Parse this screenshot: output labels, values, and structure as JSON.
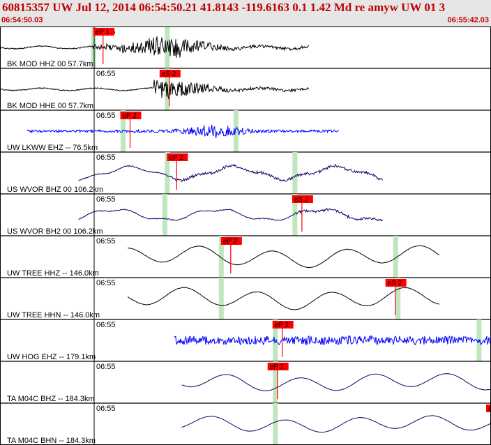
{
  "header": {
    "title": "60815357 UW Jul 12, 2014 06:54:50.21   41.8143 -119.6163  0.1 1.42 Md re amyw UW 01   3",
    "start_time": "06:54:50.03",
    "end_time": "06:55:42.03"
  },
  "colors": {
    "header_bg": "#e6e6e6",
    "header_text": "#c00000",
    "pick_red": "#ff0000",
    "window_green": "#bfe6bf",
    "trace_black": "#000000",
    "trace_blue": "#0000ff",
    "trace_navy": "#1a0066"
  },
  "tick_label": "06:55",
  "traces": [
    {
      "label": "BK MOD HHZ 00 57.7km",
      "color": "#000000",
      "type": "local",
      "start": 0.0,
      "end": 0.63,
      "onset": 0.19,
      "peak": 0.34,
      "amp": 0.78,
      "pick": {
        "label": "eP 1",
        "pos": 0.19
      },
      "window": 0.19,
      "arrival2": 0.34
    },
    {
      "label": "BK MOD HHE 00 57.7km",
      "color": "#000000",
      "type": "local",
      "start": 0.0,
      "end": 0.63,
      "onset": 0.31,
      "peak": 0.34,
      "amp": 0.72,
      "pick": {
        "label": "eS 2",
        "pos": 0.325
      },
      "window": 0.34,
      "arrival2": null
    },
    {
      "label": "UW LKWW EHZ -- 76.5km",
      "color": "#0000ff",
      "type": "noisy_event",
      "start": 0.055,
      "end": 0.69,
      "onset": 0.25,
      "peak": 0.44,
      "amp": 0.55,
      "pick": {
        "label": "eP 2",
        "pos": 0.245
      },
      "window": 0.25,
      "arrival2": 0.48
    },
    {
      "label": "US WVOR BHZ 00 106.2km",
      "color": "#1a0066",
      "type": "long",
      "start": 0.16,
      "end": 0.78,
      "onset": 0.34,
      "peak": 0.6,
      "amp": 0.6,
      "pick": {
        "label": "eP 2",
        "pos": 0.34
      },
      "window": 0.34,
      "arrival2": 0.6
    },
    {
      "label": "US WVOR BH2 00 106.2km",
      "color": "#1a0066",
      "type": "long",
      "start": 0.16,
      "end": 0.78,
      "onset": 0.6,
      "peak": 0.62,
      "amp": 0.55,
      "pick": {
        "label": "eS 2",
        "pos": 0.595
      },
      "window": 0.335,
      "arrival2": 0.6
    },
    {
      "label": "UW TREE HHZ -- 146.0km",
      "color": "#000000",
      "type": "smooth",
      "start": 0.26,
      "end": 0.895,
      "onset": 0.45,
      "peak": 0.5,
      "amp": 0.7,
      "pick": {
        "label": "eP 2",
        "pos": 0.45
      },
      "window": 0.45,
      "arrival2": 0.805
    },
    {
      "label": "UW TREE HHN -- 146.0km",
      "color": "#000000",
      "type": "smooth",
      "start": 0.26,
      "end": 0.895,
      "onset": 0.81,
      "peak": 0.85,
      "amp": 0.7,
      "pick": {
        "label": "eS 2",
        "pos": 0.785
      },
      "window": 0.81,
      "arrival2": 0.45
    },
    {
      "label": "UW HOG EHZ -- 179.1km",
      "color": "#0000ff",
      "type": "noise",
      "start": 0.355,
      "end": 1.0,
      "onset": 0.56,
      "peak": 0.6,
      "amp": 0.55,
      "pick": {
        "label": "eP 2",
        "pos": 0.555
      },
      "window": 0.56,
      "arrival2": 0.975
    },
    {
      "label": "TA M04C BHZ -- 184.3km",
      "color": "#1a0066",
      "type": "smooth",
      "start": 0.37,
      "end": 1.0,
      "onset": 0.555,
      "peak": 0.6,
      "amp": 0.6,
      "pick": {
        "label": "eP 2",
        "pos": 0.545
      },
      "window": 0.56,
      "arrival2": null
    },
    {
      "label": "TA M04C BHN -- 184.3km",
      "color": "#1a0066",
      "type": "smooth",
      "start": 0.37,
      "end": 1.0,
      "onset": 0.0,
      "peak": 0.6,
      "amp": 0.55,
      "pick": {
        "label": "e",
        "pos": 0.99
      },
      "window": 0.56,
      "arrival2": null
    }
  ]
}
